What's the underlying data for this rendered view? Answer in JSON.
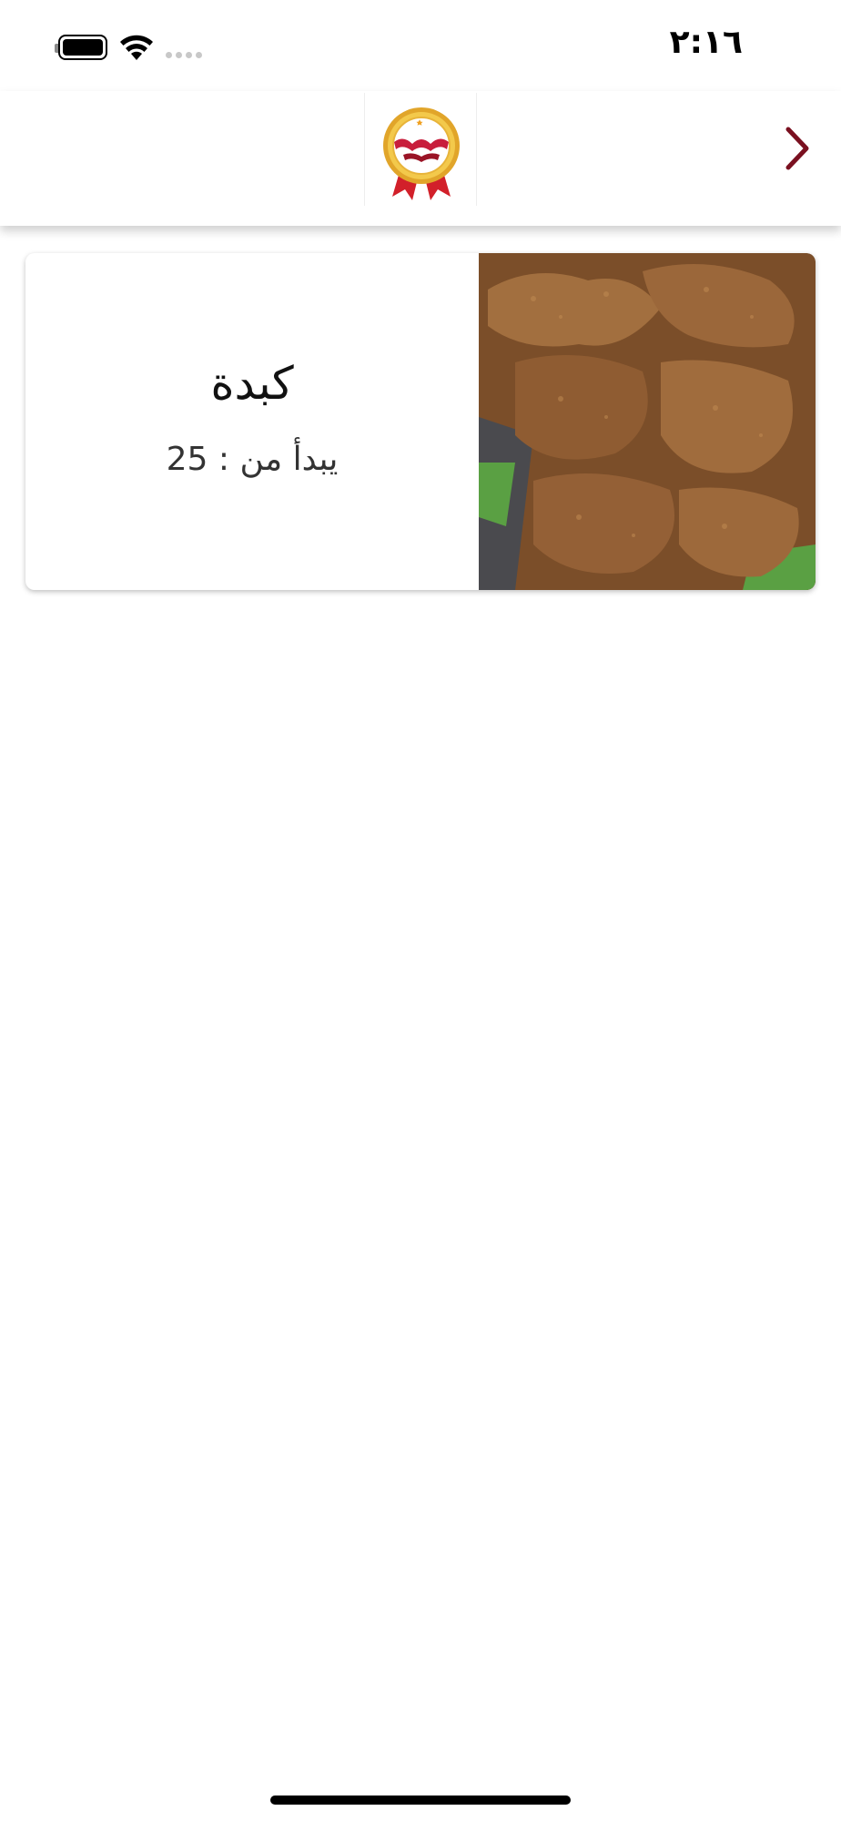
{
  "status_bar": {
    "time": "٢:١٦",
    "battery_icon": "battery-icon",
    "wifi_icon": "wifi-icon",
    "signal_icon": "signal-dots-icon"
  },
  "header": {
    "logo_icon": "brand-logo-badge",
    "back_icon": "chevron-right-icon",
    "accent_color": "#7a1020"
  },
  "product": {
    "name": "كبدة",
    "price_label": "يبدأ من : 25",
    "image_icon": "fried-liver-photo"
  }
}
